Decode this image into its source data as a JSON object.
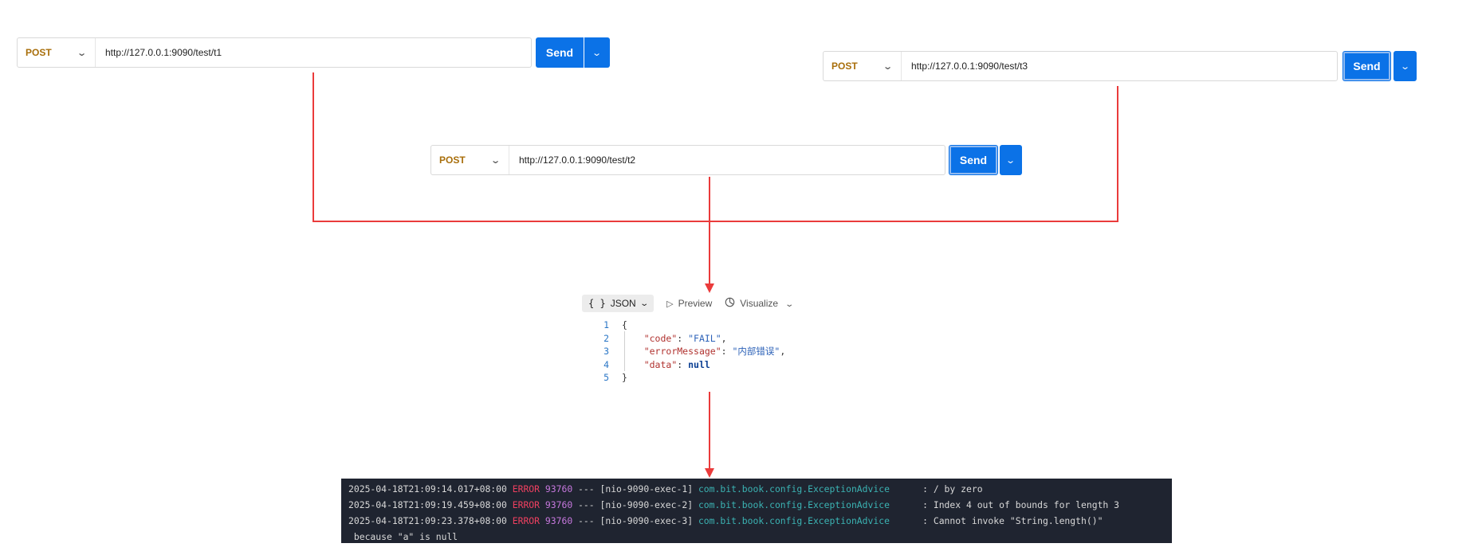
{
  "requests": [
    {
      "id": "t1",
      "method": "POST",
      "url": "http://127.0.0.1:9090/test/t1",
      "send_label": "Send"
    },
    {
      "id": "t3",
      "method": "POST",
      "url": "http://127.0.0.1:9090/test/t3",
      "send_label": "Send"
    },
    {
      "id": "t2",
      "method": "POST",
      "url": "http://127.0.0.1:9090/test/t2",
      "send_label": "Send"
    }
  ],
  "response": {
    "toolbar": {
      "format_label": "JSON",
      "preview_label": "Preview",
      "visualize_label": "Visualize"
    },
    "lines": [
      {
        "num": "1",
        "open": "{"
      },
      {
        "num": "2",
        "key": "\"code\"",
        "value": "\"FAIL\"",
        "value_type": "string"
      },
      {
        "num": "3",
        "key": "\"errorMessage\"",
        "value": "\"内部错误\"",
        "value_type": "string"
      },
      {
        "num": "4",
        "key": "\"data\"",
        "value": "null",
        "value_type": "null"
      },
      {
        "num": "5",
        "close": "}"
      }
    ]
  },
  "log": [
    {
      "timestamp": "2025-04-18T21:09:14.017+08:00",
      "level": "ERROR",
      "pid": "93760",
      "sep": "---",
      "thread": "[nio-9090-exec-1]",
      "logger": "com.bit.book.config.ExceptionAdvice",
      "message": ": / by zero"
    },
    {
      "timestamp": "2025-04-18T21:09:19.459+08:00",
      "level": "ERROR",
      "pid": "93760",
      "sep": "---",
      "thread": "[nio-9090-exec-2]",
      "logger": "com.bit.book.config.ExceptionAdvice",
      "message": ": Index 4 out of bounds for length 3"
    },
    {
      "timestamp": "2025-04-18T21:09:23.378+08:00",
      "level": "ERROR",
      "pid": "93760",
      "sep": "---",
      "thread": "[nio-9090-exec-3]",
      "logger": "com.bit.book.config.ExceptionAdvice",
      "message": ": Cannot invoke \"String.length()\""
    }
  ],
  "log_continuation": " because \"a\" is null",
  "icons": [
    "chevron-down-icon",
    "json-braces-icon",
    "play-icon",
    "visualize-icon"
  ],
  "colors": {
    "send": "#0b72e7",
    "arrow": "#ea3b3b",
    "method": "#a86e0a",
    "log_bg": "#1f2430"
  }
}
